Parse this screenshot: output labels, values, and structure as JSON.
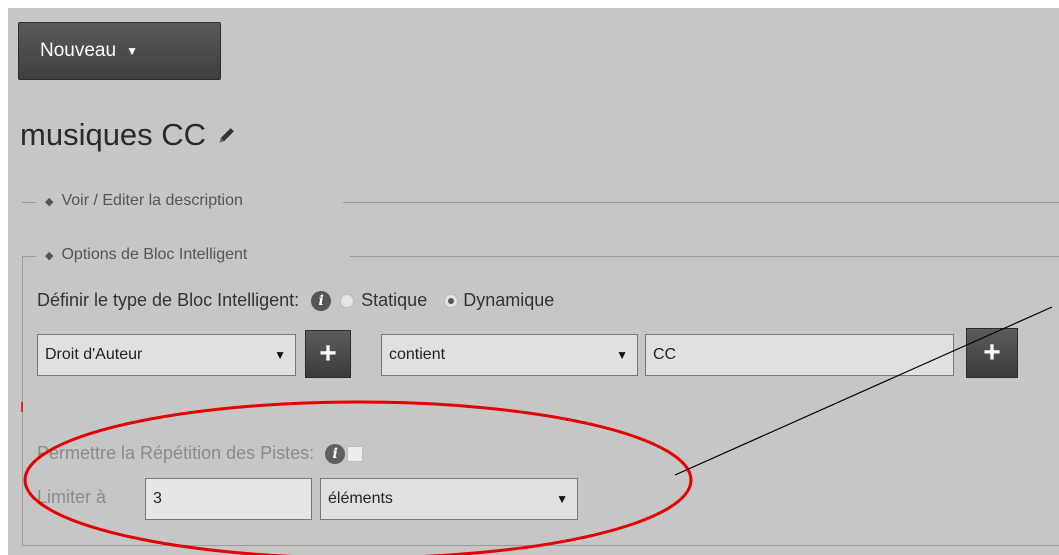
{
  "toolbar": {
    "new_label": "Nouveau",
    "new_caret": "▼"
  },
  "playlist": {
    "title": "musiques CC"
  },
  "description_section": {
    "label": "Voir / Editer la description",
    "toggle_glyph": "◆"
  },
  "options_section": {
    "label": "Options de Bloc Intelligent",
    "toggle_glyph": "◆",
    "type_label": "Définir le type de Bloc Intelligent:",
    "info_glyph": "i",
    "radio_static_label": "Statique",
    "radio_dynamic_label": "Dynamique",
    "selected_type": "Dynamique",
    "criteria": {
      "field_value": "Droit d'Auteur",
      "operator_value": "contient",
      "text_value": "CC",
      "dropdown_glyph": "▼",
      "plus_glyph": "+"
    },
    "repeat_label": "Permettre la Répétition des Pistes:",
    "repeat_checked": false,
    "limit_label": "Limiter à",
    "limit_value": "3",
    "limit_unit": "éléments"
  },
  "colors": {
    "panel": "#c6c6c6",
    "button_dark": "#444444",
    "annotation_red": "#e20000"
  }
}
